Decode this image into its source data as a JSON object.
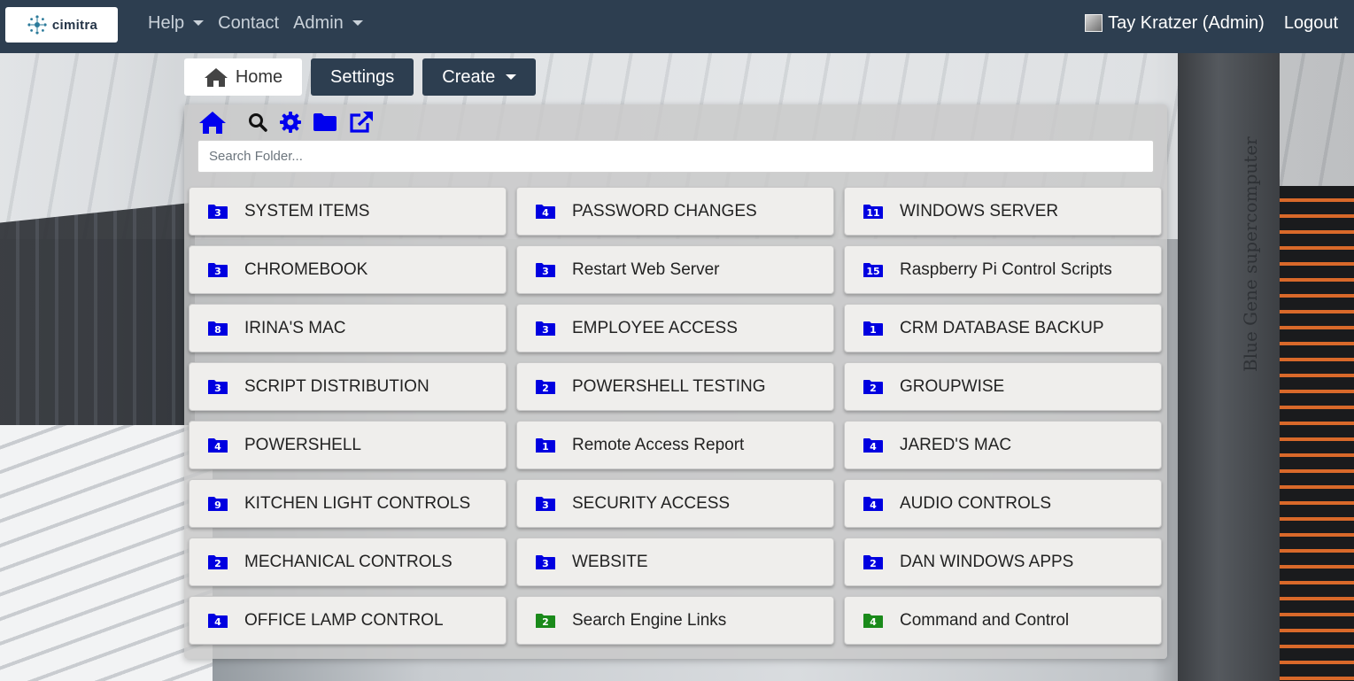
{
  "brand": {
    "name": "cimitra"
  },
  "nav": {
    "help_label": "Help",
    "contact_label": "Contact",
    "admin_label": "Admin",
    "user_label": "Tay Kratzer (Admin)",
    "logout_label": "Logout"
  },
  "tabs": {
    "home_label": "Home",
    "settings_label": "Settings",
    "create_label": "Create"
  },
  "search": {
    "placeholder": "Search Folder..."
  },
  "background": {
    "tower_text": "Blue Gene supercomputer"
  },
  "colors": {
    "navbar": "#2d3e50",
    "icon_blue": "#0000ee",
    "folder_blue": "#0000e0",
    "folder_green": "#1a8a1a"
  },
  "toolbar_icons": [
    "home-icon",
    "search-icon",
    "gear-icon",
    "folder-icon",
    "external-link-icon"
  ],
  "folders": [
    {
      "label": "SYSTEM ITEMS",
      "count": "3",
      "color": "blue"
    },
    {
      "label": "PASSWORD CHANGES",
      "count": "4",
      "color": "blue"
    },
    {
      "label": "WINDOWS SERVER",
      "count": "11",
      "color": "blue"
    },
    {
      "label": "CHROMEBOOK",
      "count": "3",
      "color": "blue"
    },
    {
      "label": "Restart Web Server",
      "count": "3",
      "color": "blue"
    },
    {
      "label": "Raspberry Pi Control Scripts",
      "count": "15",
      "color": "blue"
    },
    {
      "label": "IRINA'S MAC",
      "count": "8",
      "color": "blue"
    },
    {
      "label": "EMPLOYEE ACCESS",
      "count": "3",
      "color": "blue"
    },
    {
      "label": "CRM DATABASE BACKUP",
      "count": "1",
      "color": "blue"
    },
    {
      "label": "SCRIPT DISTRIBUTION",
      "count": "3",
      "color": "blue"
    },
    {
      "label": "POWERSHELL TESTING",
      "count": "2",
      "color": "blue"
    },
    {
      "label": "GROUPWISE",
      "count": "2",
      "color": "blue"
    },
    {
      "label": "POWERSHELL",
      "count": "4",
      "color": "blue"
    },
    {
      "label": "Remote Access Report",
      "count": "1",
      "color": "blue"
    },
    {
      "label": "JARED'S MAC",
      "count": "4",
      "color": "blue"
    },
    {
      "label": "KITCHEN LIGHT CONTROLS",
      "count": "9",
      "color": "blue"
    },
    {
      "label": "SECURITY ACCESS",
      "count": "3",
      "color": "blue"
    },
    {
      "label": "AUDIO CONTROLS",
      "count": "4",
      "color": "blue"
    },
    {
      "label": "MECHANICAL CONTROLS",
      "count": "2",
      "color": "blue"
    },
    {
      "label": "WEBSITE",
      "count": "3",
      "color": "blue"
    },
    {
      "label": "DAN WINDOWS APPS",
      "count": "2",
      "color": "blue"
    },
    {
      "label": "OFFICE LAMP CONTROL",
      "count": "4",
      "color": "blue"
    },
    {
      "label": "Search Engine Links",
      "count": "2",
      "color": "green"
    },
    {
      "label": "Command and Control",
      "count": "4",
      "color": "green"
    }
  ]
}
